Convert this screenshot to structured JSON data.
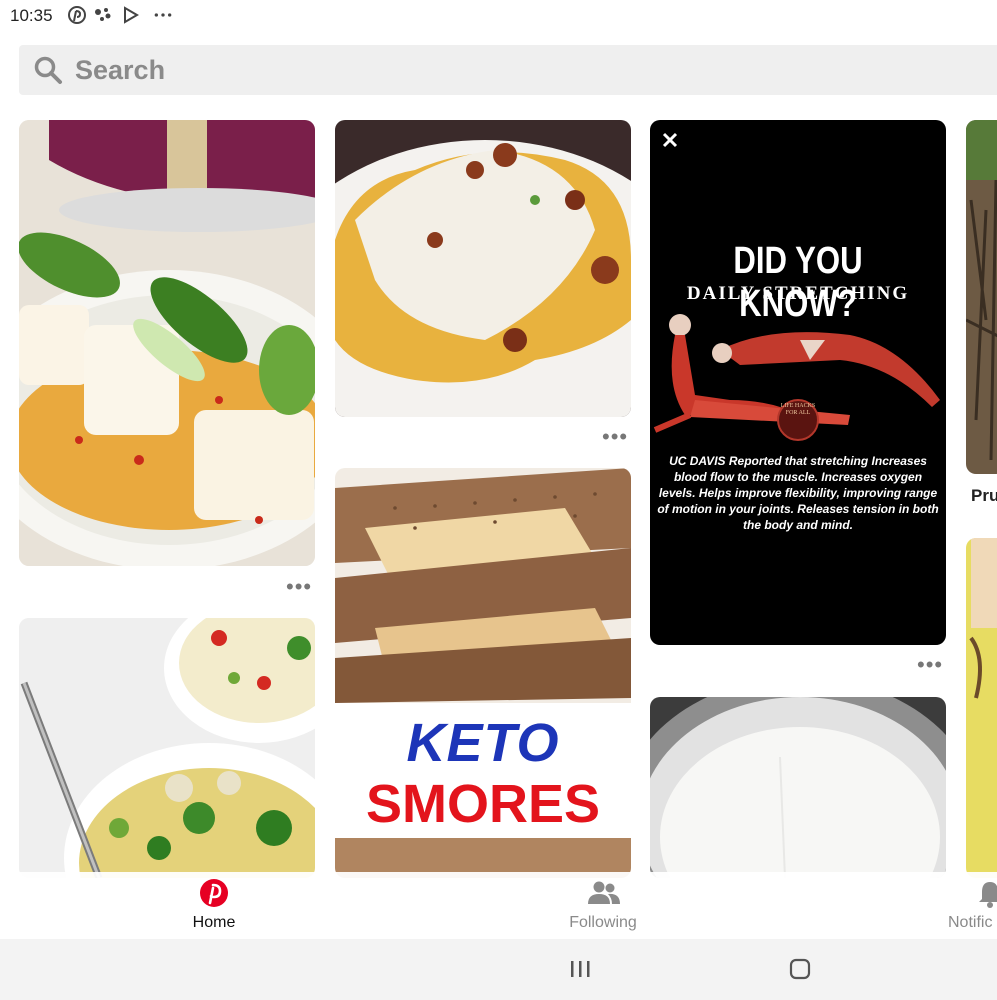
{
  "status_bar": {
    "time": "10:35"
  },
  "search": {
    "placeholder": "Search"
  },
  "pins": {
    "stretching": {
      "headline": "DID YOU KNOW?",
      "subheadline": "DAILY STRETCHING",
      "badge": "LIFE HACKS FOR ALL",
      "body": "UC DAVIS Reported that stretching Increases blood flow to the muscle. Increases oxygen levels. Helps improve flexibility, improving range of motion in your joints. Releases tension in both the body and mind."
    },
    "smores": {
      "line1": "KETO",
      "line2": "SMORES"
    },
    "partial_title": "Pru"
  },
  "more_label": "•••",
  "nav": {
    "home": "Home",
    "following": "Following",
    "notifications": "Notific"
  },
  "colors": {
    "brand": "#e60023",
    "search_bg": "#efefef",
    "nav_inactive": "#8a8a8a"
  }
}
